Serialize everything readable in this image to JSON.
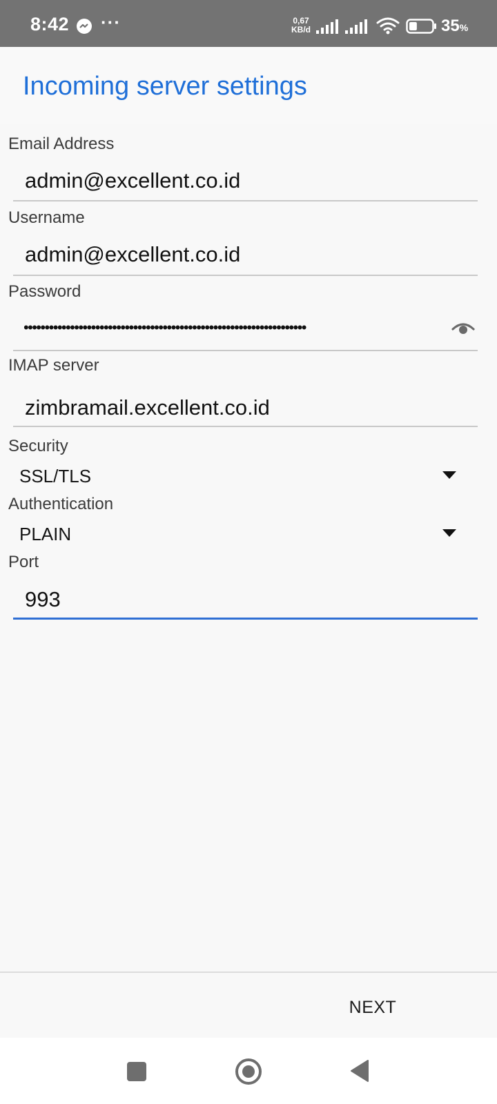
{
  "status_bar": {
    "time": "8:42",
    "more_notifications": "···",
    "net_speed_value": "0,67",
    "net_speed_unit": "KB/d",
    "battery_level": "35",
    "battery_unit": "%",
    "battery_fraction": 0.35,
    "icons": [
      "messenger-icon",
      "signal-icon",
      "signal-icon",
      "wifi-icon",
      "battery-icon"
    ]
  },
  "header": {
    "title": "Incoming server settings"
  },
  "form": {
    "email": {
      "label": "Email Address",
      "value": "admin@excellent.co.id"
    },
    "username": {
      "label": "Username",
      "value": "admin@excellent.co.id"
    },
    "password": {
      "label": "Password",
      "value": "•••••••••••••••••••••••••••••••••••••••••••••••••••••••••••••••••••"
    },
    "imap_server": {
      "label": "IMAP server",
      "value": "zimbramail.excellent.co.id"
    },
    "security": {
      "label": "Security",
      "value": "SSL/TLS"
    },
    "authentication": {
      "label": "Authentication",
      "value": "PLAIN"
    },
    "port": {
      "label": "Port",
      "value": "993"
    }
  },
  "footer": {
    "next_label": "NEXT"
  },
  "nav_bar": {
    "icons": [
      "recent-apps-icon",
      "home-icon",
      "back-icon"
    ]
  },
  "colors": {
    "accent": "#1f6fd8",
    "status_bar": "#737373",
    "background": "#f8f8f8"
  }
}
